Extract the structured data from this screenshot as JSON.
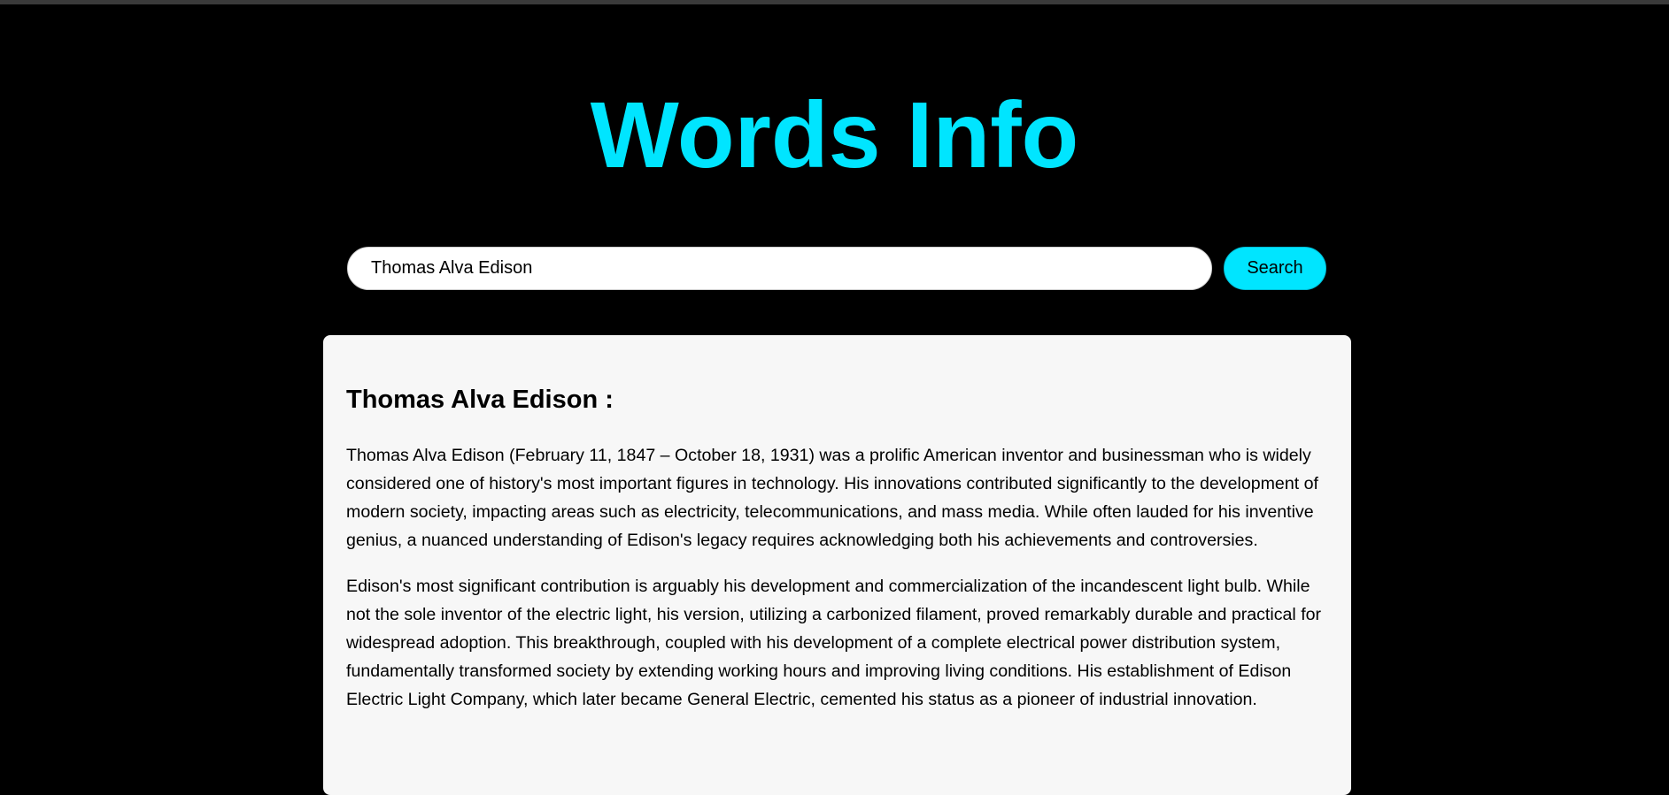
{
  "header": {
    "title": "Words Info"
  },
  "search": {
    "value": "Thomas Alva Edison",
    "button_label": "Search"
  },
  "result": {
    "heading": "Thomas Alva Edison :",
    "paragraphs": [
      "Thomas Alva Edison (February 11, 1847 – October 18, 1931) was a prolific American inventor and businessman who is widely considered one of history's most important figures in technology. His innovations contributed significantly to the development of modern society, impacting areas such as electricity, telecommunications, and mass media. While often lauded for his inventive genius, a nuanced understanding of Edison's legacy requires acknowledging both his achievements and controversies.",
      "Edison's most significant contribution is arguably his development and commercialization of the incandescent light bulb. While not the sole inventor of the electric light, his version, utilizing a carbonized filament, proved remarkably durable and practical for widespread adoption. This breakthrough, coupled with his development of a complete electrical power distribution system, fundamentally transformed society by extending working hours and improving living conditions. His establishment of Edison Electric Light Company, which later became General Electric, cemented his status as a pioneer of industrial innovation."
    ]
  }
}
